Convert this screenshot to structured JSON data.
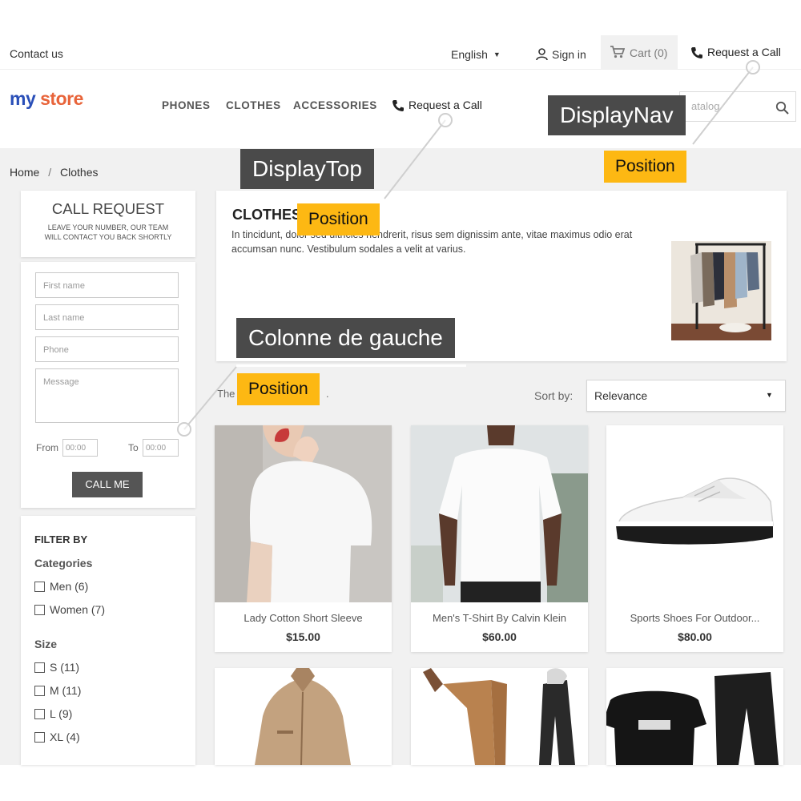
{
  "topbar": {
    "contact": "Contact us",
    "language": "English",
    "sign_in": "Sign in",
    "cart": "Cart (0)",
    "request_call": "Request a Call"
  },
  "header": {
    "logo_my": "my",
    "logo_store": "store",
    "menu": [
      "PHONES",
      "CLOTHES",
      "ACCESSORIES"
    ],
    "request_call": "Request a Call",
    "search_placeholder": "atalog"
  },
  "breadcrumb": {
    "home": "Home",
    "separator": "/",
    "current": "Clothes"
  },
  "call_request": {
    "title": "CALL REQUEST",
    "subtitle_line1": "LEAVE YOUR NUMBER, OUR TEAM",
    "subtitle_line2": "WILL CONTACT YOU BACK SHORTLY",
    "first_name": "First name",
    "last_name": "Last name",
    "phone": "Phone",
    "message": "Message",
    "from_label": "From",
    "from_value": "00:00",
    "to_label": "To",
    "to_value": "00:00",
    "button": "CALL ME"
  },
  "filter": {
    "title": "FILTER BY",
    "categories_label": "Categories",
    "categories": [
      "Men (6)",
      "Women (7)"
    ],
    "size_label": "Size",
    "sizes": [
      "S (11)",
      "M (11)",
      "L (9)",
      "XL (4)"
    ]
  },
  "category": {
    "title": "CLOTHES",
    "desc_line1": "In tincidunt, dolor sed ultricies hendrerit, risus sem dignissim ante, vitae maximus odio erat",
    "desc_line2": "accumsan nunc. Vestibulum sodales a velit at varius."
  },
  "listing": {
    "count_prefix": "The",
    "count_suffix": ".",
    "sort_label": "Sort by:",
    "sort_value": "Relevance"
  },
  "products": [
    {
      "name": "Lady Cotton Short Sleeve",
      "price": "$15.00"
    },
    {
      "name": "Men's T-Shirt By Calvin Klein",
      "price": "$60.00"
    },
    {
      "name": "Sports Shoes For Outdoor...",
      "price": "$80.00"
    }
  ],
  "annotations": {
    "display_nav": "DisplayNav",
    "display_top": "DisplayTop",
    "left_column": "Colonne de gauche",
    "position": "Position"
  },
  "colors": {
    "annotation_dark": "#4a4a4a",
    "annotation_yellow": "#fdb813",
    "button_dark": "#555555",
    "page_gray": "#f1f1f1"
  }
}
